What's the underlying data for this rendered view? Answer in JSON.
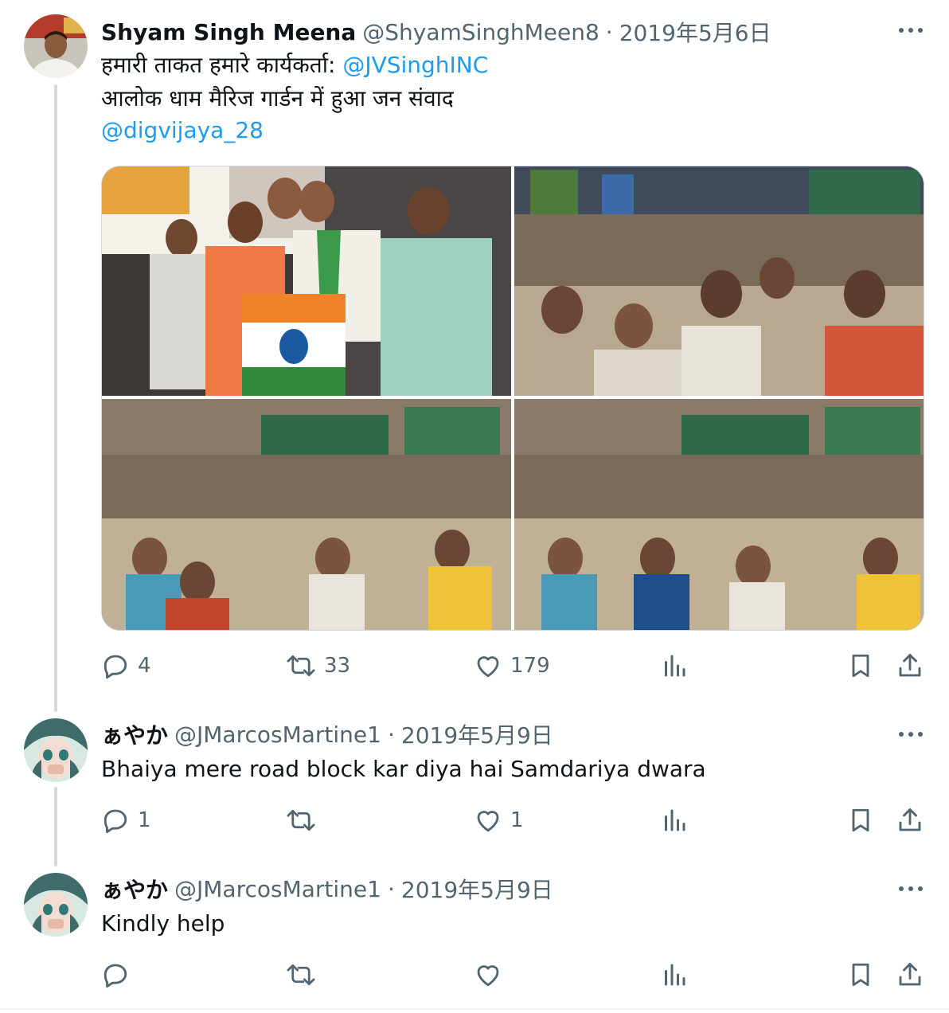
{
  "main_tweet": {
    "author_name": "Shyam Singh Meena",
    "handle": "@ShyamSinghMeen8",
    "separator": "·",
    "date": "2019年5月6日",
    "line1_text": "हमारी ताकत हमारे कार्यकर्ता: ",
    "line1_mention": "@JVSinghINC",
    "line2_text": "आलोक धाम मैरिज गार्डन में हुआ जन संवाद",
    "line3_mention": "@digvijaya_28",
    "media": {
      "photos": [
        "stage-speakers-photo",
        "crowd-photo",
        "audience-left-photo",
        "audience-right-photo"
      ]
    },
    "stats": {
      "replies": "4",
      "retweets": "33",
      "likes": "179"
    }
  },
  "reply_1": {
    "author_name": "ぁやか",
    "handle": "@JMarcosMartine1",
    "separator": "·",
    "date": "2019年5月9日",
    "text": "Bhaiya mere road block kar diya hai Samdariya dwara",
    "stats": {
      "replies": "1",
      "likes": "1"
    }
  },
  "reply_2": {
    "author_name": "ぁやか",
    "handle": "@JMarcosMartine1",
    "separator": "·",
    "date": "2019年5月9日",
    "text": "Kindly help"
  },
  "icons": [
    "more-icon",
    "reply-icon",
    "retweet-icon",
    "like-icon",
    "views-icon",
    "bookmark-icon",
    "share-icon"
  ],
  "colors": {
    "link": "#1d9bf0",
    "secondary_text": "#536471",
    "thread_line": "#cfd9de",
    "primary_text": "#0f1419"
  }
}
